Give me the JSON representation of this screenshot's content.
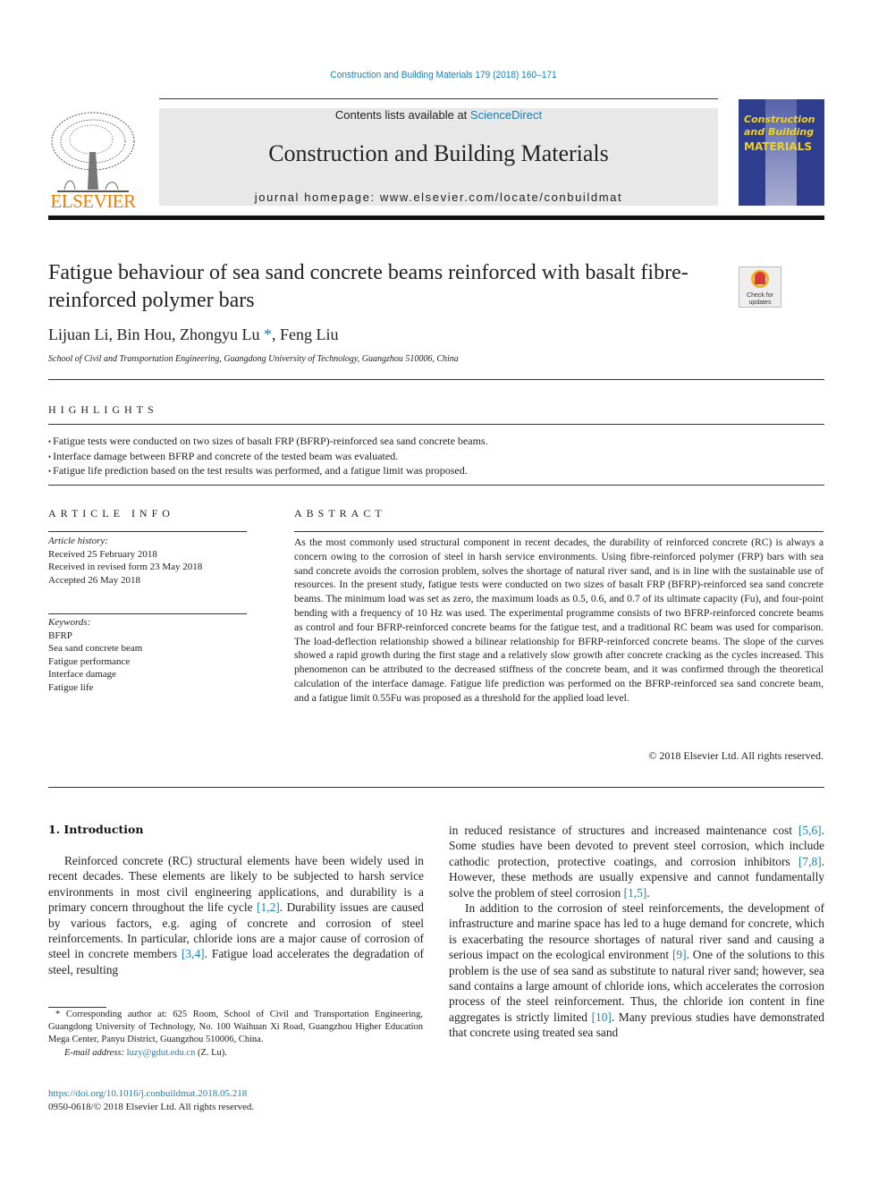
{
  "journal_citation": "Construction and Building Materials 179 (2018) 160–171",
  "header": {
    "publisher_logo_text": "ELSEVIER",
    "contents_prefix": "Contents lists available at ",
    "contents_link": "ScienceDirect",
    "journal_title": "Construction and Building Materials",
    "homepage": "journal homepage: www.elsevier.com/locate/conbuildmat",
    "cover": {
      "title_line1": "Construction",
      "title_line2": "and Building",
      "title_line3": "MATERIALS"
    },
    "colors": {
      "link": "#1a7fb0",
      "publisher_orange": "#f07c00",
      "cover_blue": "#2f3d8f",
      "cover_yellow": "#f2d21b"
    }
  },
  "article": {
    "title": "Fatigue behaviour of sea sand concrete beams reinforced with basalt fibre-reinforced polymer bars",
    "check_updates_line1": "Check for",
    "check_updates_line2": "updates",
    "authors_before": "Lijuan Li, Bin Hou, Zhongyu Lu ",
    "corresponding_mark": "*",
    "authors_after": ", Feng Liu",
    "affiliation": "School of Civil and Transportation Engineering, Guangdong University of Technology, Guangzhou 510006, China"
  },
  "highlights": {
    "label": "HIGHLIGHTS",
    "items": [
      "Fatigue tests were conducted on two sizes of basalt FRP (BFRP)-reinforced sea sand concrete beams.",
      "Interface damage between BFRP and concrete of the tested beam was evaluated.",
      "Fatigue life prediction based on the test results was performed, and a fatigue limit was proposed."
    ]
  },
  "article_info": {
    "label": "ARTICLE INFO",
    "history_label": "Article history:",
    "history": [
      "Received 25 February 2018",
      "Received in revised form 23 May 2018",
      "Accepted 26 May 2018"
    ],
    "keywords_label": "Keywords:",
    "keywords": [
      "BFRP",
      "Sea sand concrete beam",
      "Fatigue performance",
      "Interface damage",
      "Fatigue life"
    ]
  },
  "abstract": {
    "label": "ABSTRACT",
    "text": "As the most commonly used structural component in recent decades, the durability of reinforced concrete (RC) is always a concern owing to the corrosion of steel in harsh service environments. Using fibre-reinforced polymer (FRP) bars with sea sand concrete avoids the corrosion problem, solves the shortage of natural river sand, and is in line with the sustainable use of resources. In the present study, fatigue tests were conducted on two sizes of basalt FRP (BFRP)-reinforced sea sand concrete beams. The minimum load was set as zero, the maximum loads as 0.5, 0.6, and 0.7 of its ultimate capacity (Fu), and four-point bending with a frequency of 10 Hz was used. The experimental programme consists of two BFRP-reinforced concrete beams as control and four BFRP-reinforced concrete beams for the fatigue test, and a traditional RC beam was used for comparison. The load-deflection relationship showed a bilinear relationship for BFRP-reinforced concrete beams. The slope of the curves showed a rapid growth during the first stage and a relatively slow growth after concrete cracking as the cycles increased. This phenomenon can be attributed to the decreased stiffness of the concrete beam, and it was confirmed through the theoretical calculation of the interface damage. Fatigue life prediction was performed on the BFRP-reinforced sea sand concrete beam, and a fatigue limit 0.55Fu was proposed as a threshold for the applied load level.",
    "copyright": "© 2018 Elsevier Ltd. All rights reserved."
  },
  "introduction": {
    "heading": "1. Introduction",
    "left_col": {
      "p1_a": "Reinforced concrete (RC) structural elements have been widely used in recent decades. These elements are likely to be subjected to harsh service environments in most civil engineering applications, and durability is a primary concern throughout the life cycle ",
      "ref1": "[1,2]",
      "p1_b": ". Durability issues are caused by various factors, e.g. aging of concrete and corrosion of steel reinforcements. In particular, chloride ions are a major cause of corrosion of steel in concrete members ",
      "ref2": "[3,4]",
      "p1_c": ". Fatigue load accelerates the degradation of steel, resulting"
    },
    "right_col": {
      "p1_a": "in reduced resistance of structures and increased maintenance cost ",
      "ref1": "[5,6]",
      "p1_b": ". Some studies have been devoted to prevent steel corrosion, which include cathodic protection, protective coatings, and corrosion inhibitors ",
      "ref2": "[7,8]",
      "p1_c": ". However, these methods are usually expensive and cannot fundamentally solve the problem of steel corrosion ",
      "ref3": "[1,5]",
      "p1_d": ".",
      "p2_a": "In addition to the corrosion of steel reinforcements, the development of infrastructure and marine space has led to a huge demand for concrete, which is exacerbating the resource shortages of natural river sand and causing a serious impact on the ecological environment ",
      "ref4": "[9]",
      "p2_b": ". One of the solutions to this problem is the use of sea sand as substitute to natural river sand; however, sea sand contains a large amount of chloride ions, which accelerates the corrosion process of the steel reinforcement. Thus, the chloride ion content in fine aggregates is strictly limited ",
      "ref5": "[10]",
      "p2_c": ". Many previous studies have demonstrated that concrete using treated sea sand"
    }
  },
  "footnote": {
    "corresponding": "* Corresponding author at: 625 Room, School of Civil and Transportation Engineering, Guangdong University of Technology, No. 100 Waihuan Xi Road, Guangzhou Higher Education Mega Center, Panyu District, Guangzhou 510006, China.",
    "email_label": "E-mail address: ",
    "email": "luzy@gdut.edu.cn",
    "email_suffix": " (Z. Lu).",
    "doi": "https://doi.org/10.1016/j.conbuildmat.2018.05.218",
    "issn": "0950-0618/© 2018 Elsevier Ltd. All rights reserved."
  }
}
